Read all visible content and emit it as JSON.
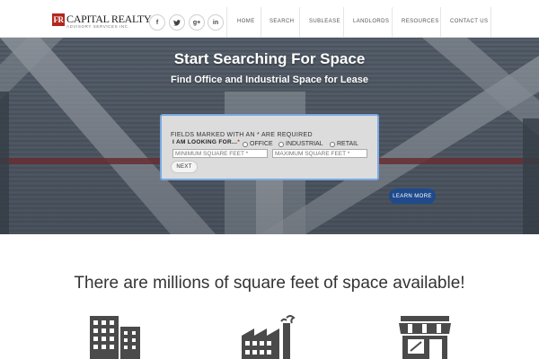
{
  "header": {
    "logo": {
      "mark": "FR",
      "name": "CAPITAL REALTY",
      "tagline": "ADVISORY SERVICES INC."
    },
    "social": [
      {
        "label": "f",
        "icon": "facebook-icon"
      },
      {
        "label": "y",
        "icon": "twitter-icon"
      },
      {
        "label": "g+",
        "icon": "google-plus-icon"
      },
      {
        "label": "in",
        "icon": "linkedin-icon"
      }
    ],
    "nav": [
      {
        "label": "HOME"
      },
      {
        "label": "SEARCH"
      },
      {
        "label": "SUBLEASE"
      },
      {
        "label": "LANDLORDS"
      },
      {
        "label": "RESOURCES"
      },
      {
        "label": "CONTACT US"
      }
    ]
  },
  "hero": {
    "title": "Start Searching For Space",
    "subtitle": "Find Office and Industrial Space for Lease",
    "form": {
      "required_note": "FIELDS MARKED WITH AN * ARE REQUIRED",
      "looking_label": "I AM LOOKING FOR...",
      "required_star": "*",
      "options": [
        {
          "label": "OFFICE",
          "selected": false
        },
        {
          "label": "INDUSTRIAL",
          "selected": false
        },
        {
          "label": "RETAIL",
          "selected": false
        }
      ],
      "min_sqft_placeholder": "MINIMUM SQUARE FEET *",
      "max_sqft_placeholder": "MAXIMUM SQUARE FEET *",
      "next_label": "NEXT"
    },
    "learn_more_label": "LEARN MORE"
  },
  "section": {
    "heading": "There are millions of square feet of space available!",
    "icons": [
      "office-buildings-icon",
      "factory-icon",
      "retail-storefront-icon"
    ]
  },
  "colors": {
    "brand_red": "#b3261e",
    "button_blue": "#1f4a8c",
    "form_border": "#7aa8e0"
  }
}
